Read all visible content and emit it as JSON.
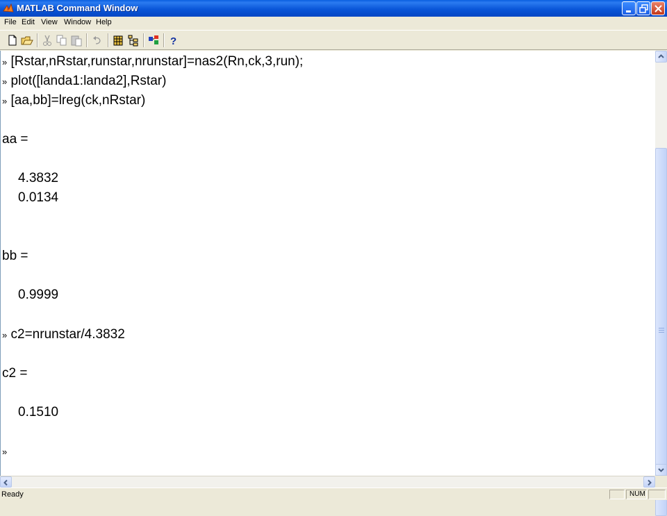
{
  "window": {
    "title": "MATLAB Command Window",
    "controls": {
      "minimize_icon": "minimize-icon",
      "restore_icon": "restore-icon",
      "close_icon": "close-icon"
    }
  },
  "menu": [
    "File",
    "Edit",
    "View",
    "Window",
    "Help"
  ],
  "toolbar": {
    "buttons": [
      "new-file-icon",
      "open-file-icon",
      "cut-icon",
      "copy-icon",
      "paste-icon",
      "undo-icon",
      "workspace-browser-icon",
      "path-browser-icon",
      "simulink-icon",
      "help-icon"
    ]
  },
  "console": {
    "prompt_symbol": "»",
    "lines": {
      "l1": "[Rstar,nRstar,runstar,nrunstar]=nas2(Rn,ck,3,run);",
      "l2": "plot([landa1:landa2],Rstar)",
      "l3": "[aa,bb]=lreg(ck,nRstar)",
      "aa_label": "aa =",
      "aa_v1": "4.3832",
      "aa_v2": "0.0134",
      "bb_label": "bb =",
      "bb_v1": "0.9999",
      "l4": "c2=nrunstar/4.3832",
      "c2_label": "c2 =",
      "c2_v1": "0.1510"
    }
  },
  "status": {
    "text": "Ready",
    "num": "NUM"
  },
  "colors": {
    "titlebar": "#0a56d8",
    "chrome": "#ece9d8",
    "console_bg": "#ffffff"
  }
}
